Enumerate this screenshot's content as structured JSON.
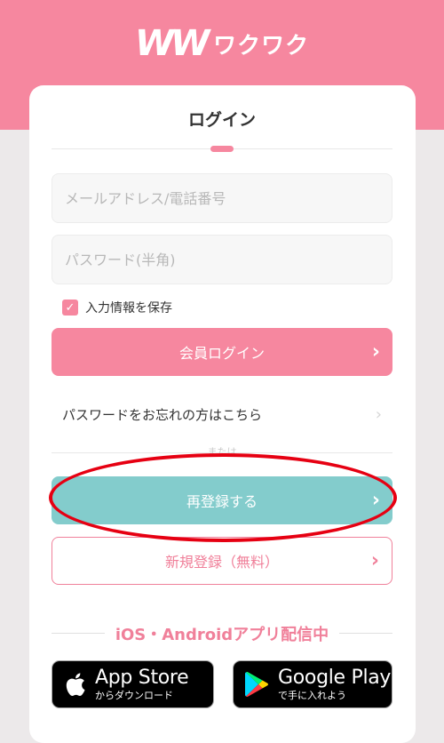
{
  "header": {
    "logo_mark": "WW",
    "logo_text": "ワクワク"
  },
  "login": {
    "title": "ログイン",
    "email_placeholder": "メールアドレス/電話番号",
    "password_placeholder": "パスワード(半角)",
    "remember_label": "入力情報を保存",
    "remember_checked": true,
    "login_button": "会員ログイン",
    "forgot_link": "パスワードをお忘れの方はこちら",
    "or_label": "または",
    "reregister_button": "再登録する",
    "register_button": "新規登録（無料）"
  },
  "apps": {
    "heading": "iOS・Androidアプリ配信中",
    "appstore_big": "App Store",
    "appstore_small": "からダウンロード",
    "google_big": "Google Play",
    "google_small": "で手に入れよう"
  },
  "colors": {
    "brand_pink": "#f6879f",
    "teal": "#83cccc",
    "highlight_red": "#e60012"
  },
  "icons": {
    "chevron": "chevron-right-icon",
    "check": "check-icon",
    "apple": "apple-icon",
    "google_play": "google-play-icon"
  }
}
